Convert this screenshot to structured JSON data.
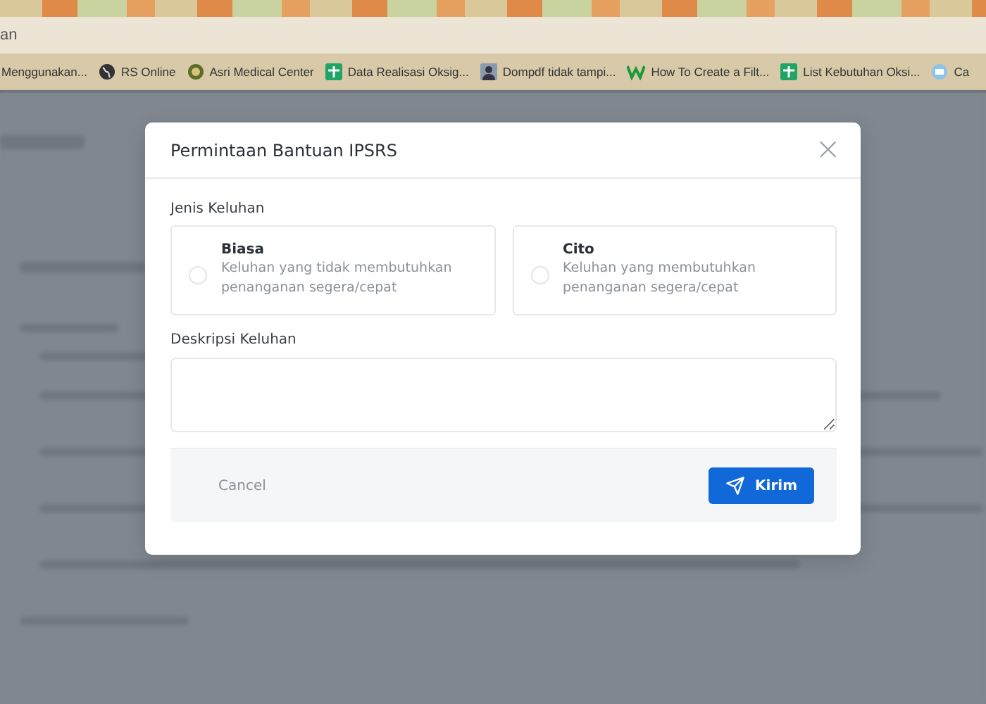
{
  "address_bar": {
    "text": "an"
  },
  "bookmarks": [
    {
      "label": "Menggunakan...",
      "kind": "plain"
    },
    {
      "label": "RS Online",
      "kind": "globe"
    },
    {
      "label": "Asri Medical Center",
      "kind": "emblem"
    },
    {
      "label": "Data Realisasi Oksig...",
      "kind": "sheet"
    },
    {
      "label": "Dompdf tidak tampi...",
      "kind": "person"
    },
    {
      "label": "How To Create a Filt...",
      "kind": "w"
    },
    {
      "label": "List Kebutuhan Oksi...",
      "kind": "sheet"
    },
    {
      "label": "Ca",
      "kind": "chat"
    }
  ],
  "modal": {
    "title": "Permintaan Bantuan IPSRS",
    "close": "×",
    "type_label": "Jenis Keluhan",
    "options": [
      {
        "title": "Biasa",
        "description": "Keluhan yang tidak membutuhkan penanganan segera/cepat",
        "selected": false
      },
      {
        "title": "Cito",
        "description": "Keluhan yang membutuhkan penanganan segera/cepat",
        "selected": false
      }
    ],
    "description_label": "Deskripsi Keluhan",
    "cancel": "Cancel",
    "submit": "Kirim"
  }
}
